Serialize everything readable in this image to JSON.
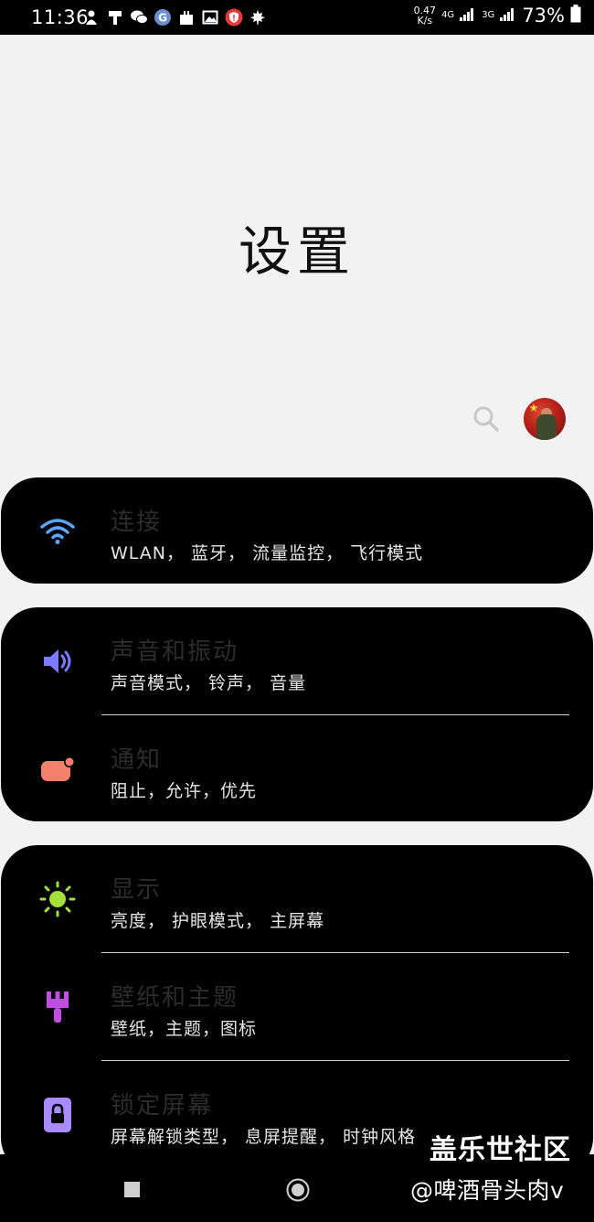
{
  "status_bar": {
    "time": "11:36",
    "net_speed_value": "0.47",
    "net_speed_unit": "K/s",
    "network_tag_1": "4G",
    "network_tag_2": "3G",
    "battery": "73%",
    "left_icons": [
      "person-icon",
      "cash-register-icon",
      "wechat-icon",
      "google-g-icon",
      "bag-icon",
      "image-icon",
      "shield-alert-icon",
      "maple-leaf-icon"
    ]
  },
  "header": {
    "title": "设置"
  },
  "cards": [
    {
      "rows": [
        {
          "icon": "wifi-icon",
          "title": "连接",
          "subtitle": "WLAN， 蓝牙， 流量监控， 飞行模式"
        }
      ]
    },
    {
      "rows": [
        {
          "icon": "speaker-icon",
          "title": "声音和振动",
          "subtitle": "声音模式， 铃声， 音量"
        },
        {
          "icon": "notification-icon",
          "title": "通知",
          "subtitle": "阻止，允许，优先"
        }
      ]
    },
    {
      "rows": [
        {
          "icon": "brightness-icon",
          "title": "显示",
          "subtitle": "亮度， 护眼模式， 主屏幕"
        },
        {
          "icon": "paint-brush-icon",
          "title": "壁纸和主题",
          "subtitle": "壁纸，主题，图标"
        },
        {
          "icon": "lock-icon",
          "title": "锁定屏幕",
          "subtitle": "屏幕解锁类型， 息屏提醒， 时钟风格"
        }
      ]
    }
  ],
  "watermark": {
    "main": "盖乐世社区",
    "sub": "@啤酒骨头肉v"
  },
  "colors": {
    "wifi": "#5aa5ff",
    "speaker": "#7b7bff",
    "notification": "#f2806b",
    "brightness": "#a5df3a",
    "brush": "#c04fe0",
    "lock": "#a88bff"
  }
}
